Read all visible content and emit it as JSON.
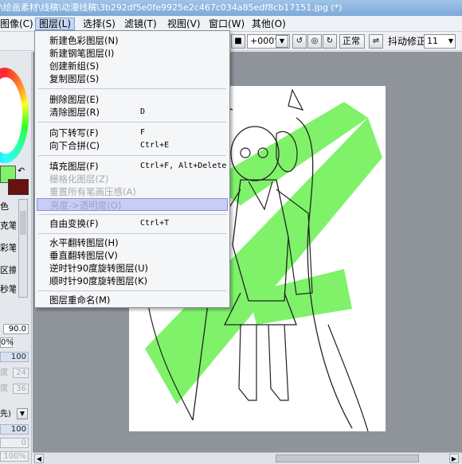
{
  "window": {
    "title": "\\绘画素材\\线稿\\动漫线稿\\3b292df5e0fe9925e2c467c034a85edf8cb17151.jpg (*)"
  },
  "menubar": {
    "items": [
      "图像(C)",
      "图层(L)",
      "选择(S)",
      "滤镜(T)",
      "视图(V)",
      "窗口(W)",
      "其他(O)"
    ],
    "active": "图层(L)"
  },
  "toolbar": {
    "rotation": "+000°",
    "blend_mode": "正常",
    "stabilizer_label": "抖动修正",
    "stabilizer_value": "11"
  },
  "layer_menu": {
    "items": [
      {
        "label": "新建色彩图层(N)",
        "shortcut": "",
        "state": "enabled"
      },
      {
        "label": "新建钢笔图层(I)",
        "shortcut": "",
        "state": "enabled"
      },
      {
        "label": "创建新组(S)",
        "shortcut": "",
        "state": "enabled"
      },
      {
        "label": "复制图层(S)",
        "shortcut": "",
        "state": "enabled"
      },
      {
        "label": "删除图层(E)",
        "shortcut": "",
        "state": "enabled"
      },
      {
        "label": "清除图层(R)",
        "shortcut": "D",
        "state": "enabled"
      },
      {
        "label": "向下转写(F)",
        "shortcut": "F",
        "state": "enabled"
      },
      {
        "label": "向下合拼(C)",
        "shortcut": "Ctrl+E",
        "state": "enabled"
      },
      {
        "label": "填充图层(F)",
        "shortcut": "Ctrl+F, Alt+Delete",
        "state": "enabled"
      },
      {
        "label": "栅格化图层(Z)",
        "shortcut": "",
        "state": "disabled"
      },
      {
        "label": "重置所有笔画压感(A)",
        "shortcut": "",
        "state": "disabled"
      },
      {
        "label": "亮度->透明度(O)",
        "shortcut": "",
        "state": "highlighted"
      },
      {
        "label": "自由变换(F)",
        "shortcut": "Ctrl+T",
        "state": "enabled"
      },
      {
        "label": "水平翻转图层(H)",
        "shortcut": "",
        "state": "enabled"
      },
      {
        "label": "垂直翻转图层(V)",
        "shortcut": "",
        "state": "enabled"
      },
      {
        "label": "逆时针90度旋转图层(U)",
        "shortcut": "",
        "state": "enabled"
      },
      {
        "label": "顺时针90度旋转图层(K)",
        "shortcut": "",
        "state": "enabled"
      },
      {
        "label": "图层重命名(M)",
        "shortcut": "",
        "state": "enabled"
      }
    ]
  },
  "left_panel": {
    "tool_labels": [
      "色",
      "克笔",
      "彩笔",
      "区擦",
      "秒笔"
    ],
    "brush_size": "90.0",
    "min_size": "0%",
    "density": "100",
    "field_a": "24",
    "field_b": "36",
    "label_a": "度",
    "label_b": "度",
    "mode_label": "先)",
    "field_c": "100",
    "field_d": "0",
    "zoom": "100%"
  },
  "colors": {
    "accent_green": "#7ff26a",
    "menu_highlight": "#c8cdf3",
    "secondary_color": "#6a1010"
  }
}
